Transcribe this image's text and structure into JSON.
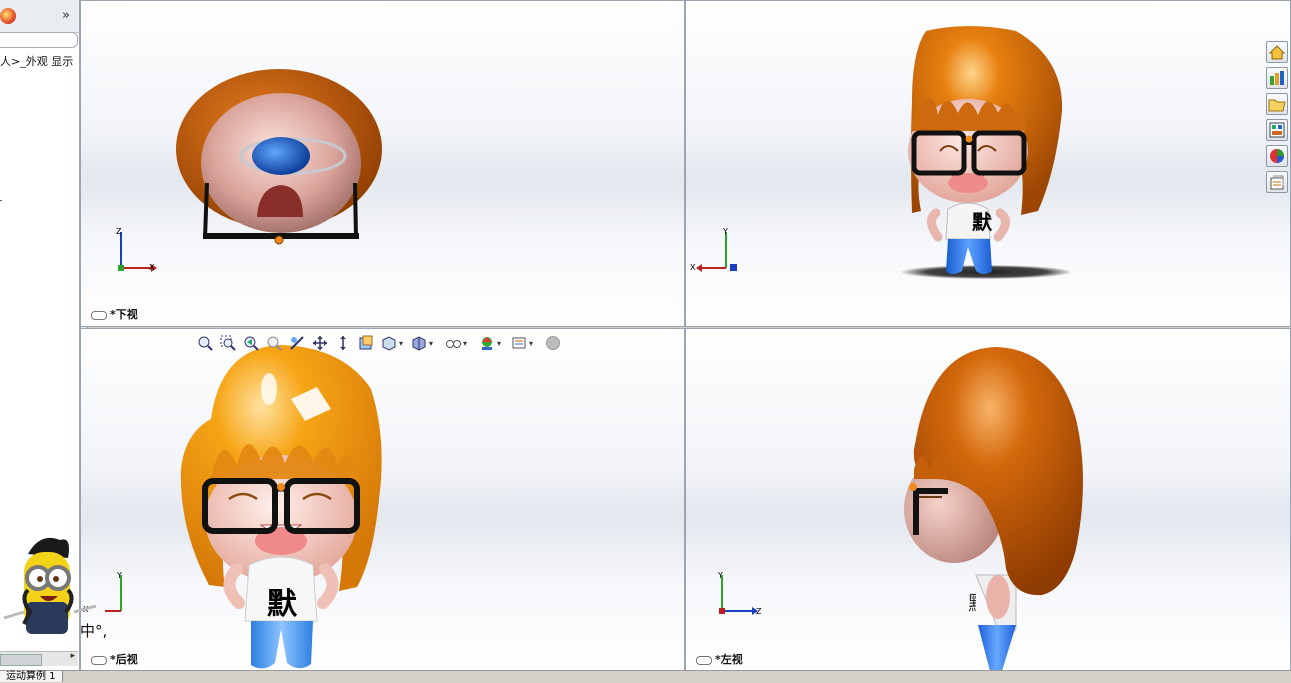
{
  "left_panel": {
    "toggle": "»",
    "text": "人>_外观 显示"
  },
  "viewports": {
    "top_left": {
      "label": "*下视",
      "axes": [
        "Z",
        "X"
      ]
    },
    "top_right": {
      "label": "",
      "axes": [
        "Y",
        "X"
      ]
    },
    "bottom_left": {
      "label": "*后视",
      "axes": [
        "Y",
        "X"
      ]
    },
    "bottom_right": {
      "label": "*左视",
      "axes": [
        "Y",
        "Z"
      ]
    }
  },
  "shirt_text": "默",
  "ime_text": "中°,",
  "status": {
    "tab": "运动算例 1"
  },
  "colors": {
    "hair": "#c45a08",
    "hair_bright": "#f49a10",
    "glasses": "#111111",
    "shirt": "#f5f5f5",
    "pants": "#2f7fe0",
    "skin": "#f3c9bf"
  }
}
